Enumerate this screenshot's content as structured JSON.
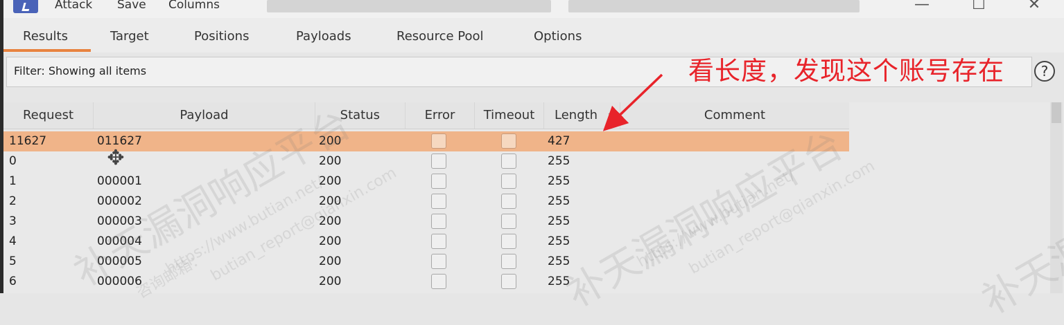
{
  "menu": {
    "items": [
      "Attack",
      "Save",
      "Columns"
    ]
  },
  "window_controls": {
    "minimize": "—",
    "maximize": "☐",
    "close": "✕"
  },
  "tabs": [
    "Results",
    "Target",
    "Positions",
    "Payloads",
    "Resource Pool",
    "Options"
  ],
  "active_tab": "Results",
  "filter": {
    "text": "Filter: Showing all items"
  },
  "help": {
    "label": "?"
  },
  "table": {
    "columns": [
      "Request",
      "Payload",
      "Status",
      "Error",
      "Timeout",
      "Length",
      "Comment"
    ],
    "sort_column": "Length",
    "sort_indicator": "⌄",
    "rows": [
      {
        "request": "11627",
        "payload": "011627",
        "status": "200",
        "error": false,
        "timeout": false,
        "length": "427",
        "comment": "",
        "selected": true
      },
      {
        "request": "0",
        "payload": "",
        "status": "200",
        "error": false,
        "timeout": false,
        "length": "255",
        "comment": "",
        "selected": false
      },
      {
        "request": "1",
        "payload": "000001",
        "status": "200",
        "error": false,
        "timeout": false,
        "length": "255",
        "comment": "",
        "selected": false
      },
      {
        "request": "2",
        "payload": "000002",
        "status": "200",
        "error": false,
        "timeout": false,
        "length": "255",
        "comment": "",
        "selected": false
      },
      {
        "request": "3",
        "payload": "000003",
        "status": "200",
        "error": false,
        "timeout": false,
        "length": "255",
        "comment": "",
        "selected": false
      },
      {
        "request": "4",
        "payload": "000004",
        "status": "200",
        "error": false,
        "timeout": false,
        "length": "255",
        "comment": "",
        "selected": false
      },
      {
        "request": "5",
        "payload": "000005",
        "status": "200",
        "error": false,
        "timeout": false,
        "length": "255",
        "comment": "",
        "selected": false
      },
      {
        "request": "6",
        "payload": "000006",
        "status": "200",
        "error": false,
        "timeout": false,
        "length": "255",
        "comment": "",
        "selected": false
      }
    ]
  },
  "annotation": {
    "text": "看长度，发现这个账号存在",
    "color": "#e8232a"
  },
  "watermark": {
    "brand": "补天漏洞响应平台",
    "url": "https://www.butian.net/",
    "email_label": "咨询邮箱：",
    "email": "butian_report@qianxin.com"
  },
  "colors": {
    "selected_row": "#f0b489",
    "tab_accent": "#e8833f",
    "app_icon": "#4a63b8"
  }
}
